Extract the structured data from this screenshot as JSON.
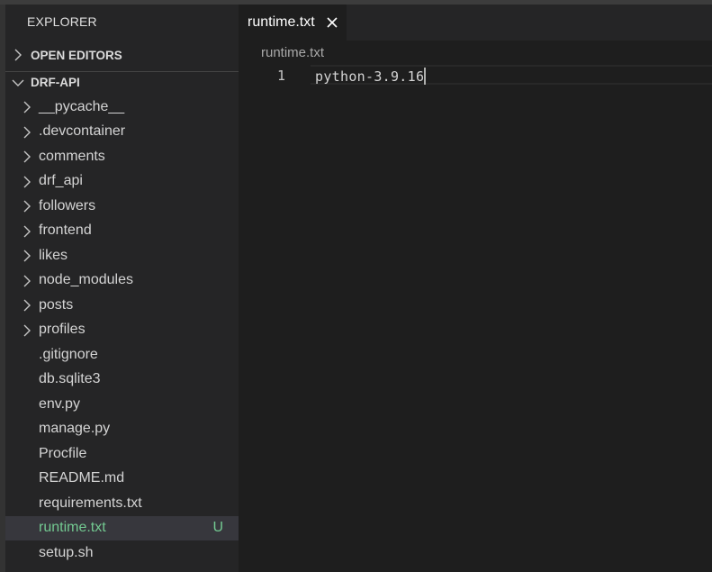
{
  "sidebar": {
    "title": "EXPLORER",
    "sections": {
      "open_editors": "OPEN EDITORS",
      "project": "DRF-API"
    },
    "tree": [
      {
        "label": "__pycache__",
        "type": "folder"
      },
      {
        "label": ".devcontainer",
        "type": "folder"
      },
      {
        "label": "comments",
        "type": "folder"
      },
      {
        "label": "drf_api",
        "type": "folder"
      },
      {
        "label": "followers",
        "type": "folder"
      },
      {
        "label": "frontend",
        "type": "folder"
      },
      {
        "label": "likes",
        "type": "folder"
      },
      {
        "label": "node_modules",
        "type": "folder"
      },
      {
        "label": "posts",
        "type": "folder"
      },
      {
        "label": "profiles",
        "type": "folder"
      },
      {
        "label": ".gitignore",
        "type": "file"
      },
      {
        "label": "db.sqlite3",
        "type": "file"
      },
      {
        "label": "env.py",
        "type": "file"
      },
      {
        "label": "manage.py",
        "type": "file"
      },
      {
        "label": "Procfile",
        "type": "file"
      },
      {
        "label": "README.md",
        "type": "file"
      },
      {
        "label": "requirements.txt",
        "type": "file"
      },
      {
        "label": "runtime.txt",
        "type": "file",
        "selected": true,
        "git_status": "U"
      },
      {
        "label": "setup.sh",
        "type": "file"
      }
    ]
  },
  "editor": {
    "tab": {
      "label": "runtime.txt",
      "close_icon": "close-icon"
    },
    "breadcrumb": "runtime.txt",
    "lines": [
      {
        "number": "1",
        "text": "python-3.9.16"
      }
    ]
  },
  "colors": {
    "untracked": "#73c991",
    "sidebar_bg": "#252526",
    "editor_bg": "#1e1e1e",
    "selected_bg": "#37373d"
  }
}
